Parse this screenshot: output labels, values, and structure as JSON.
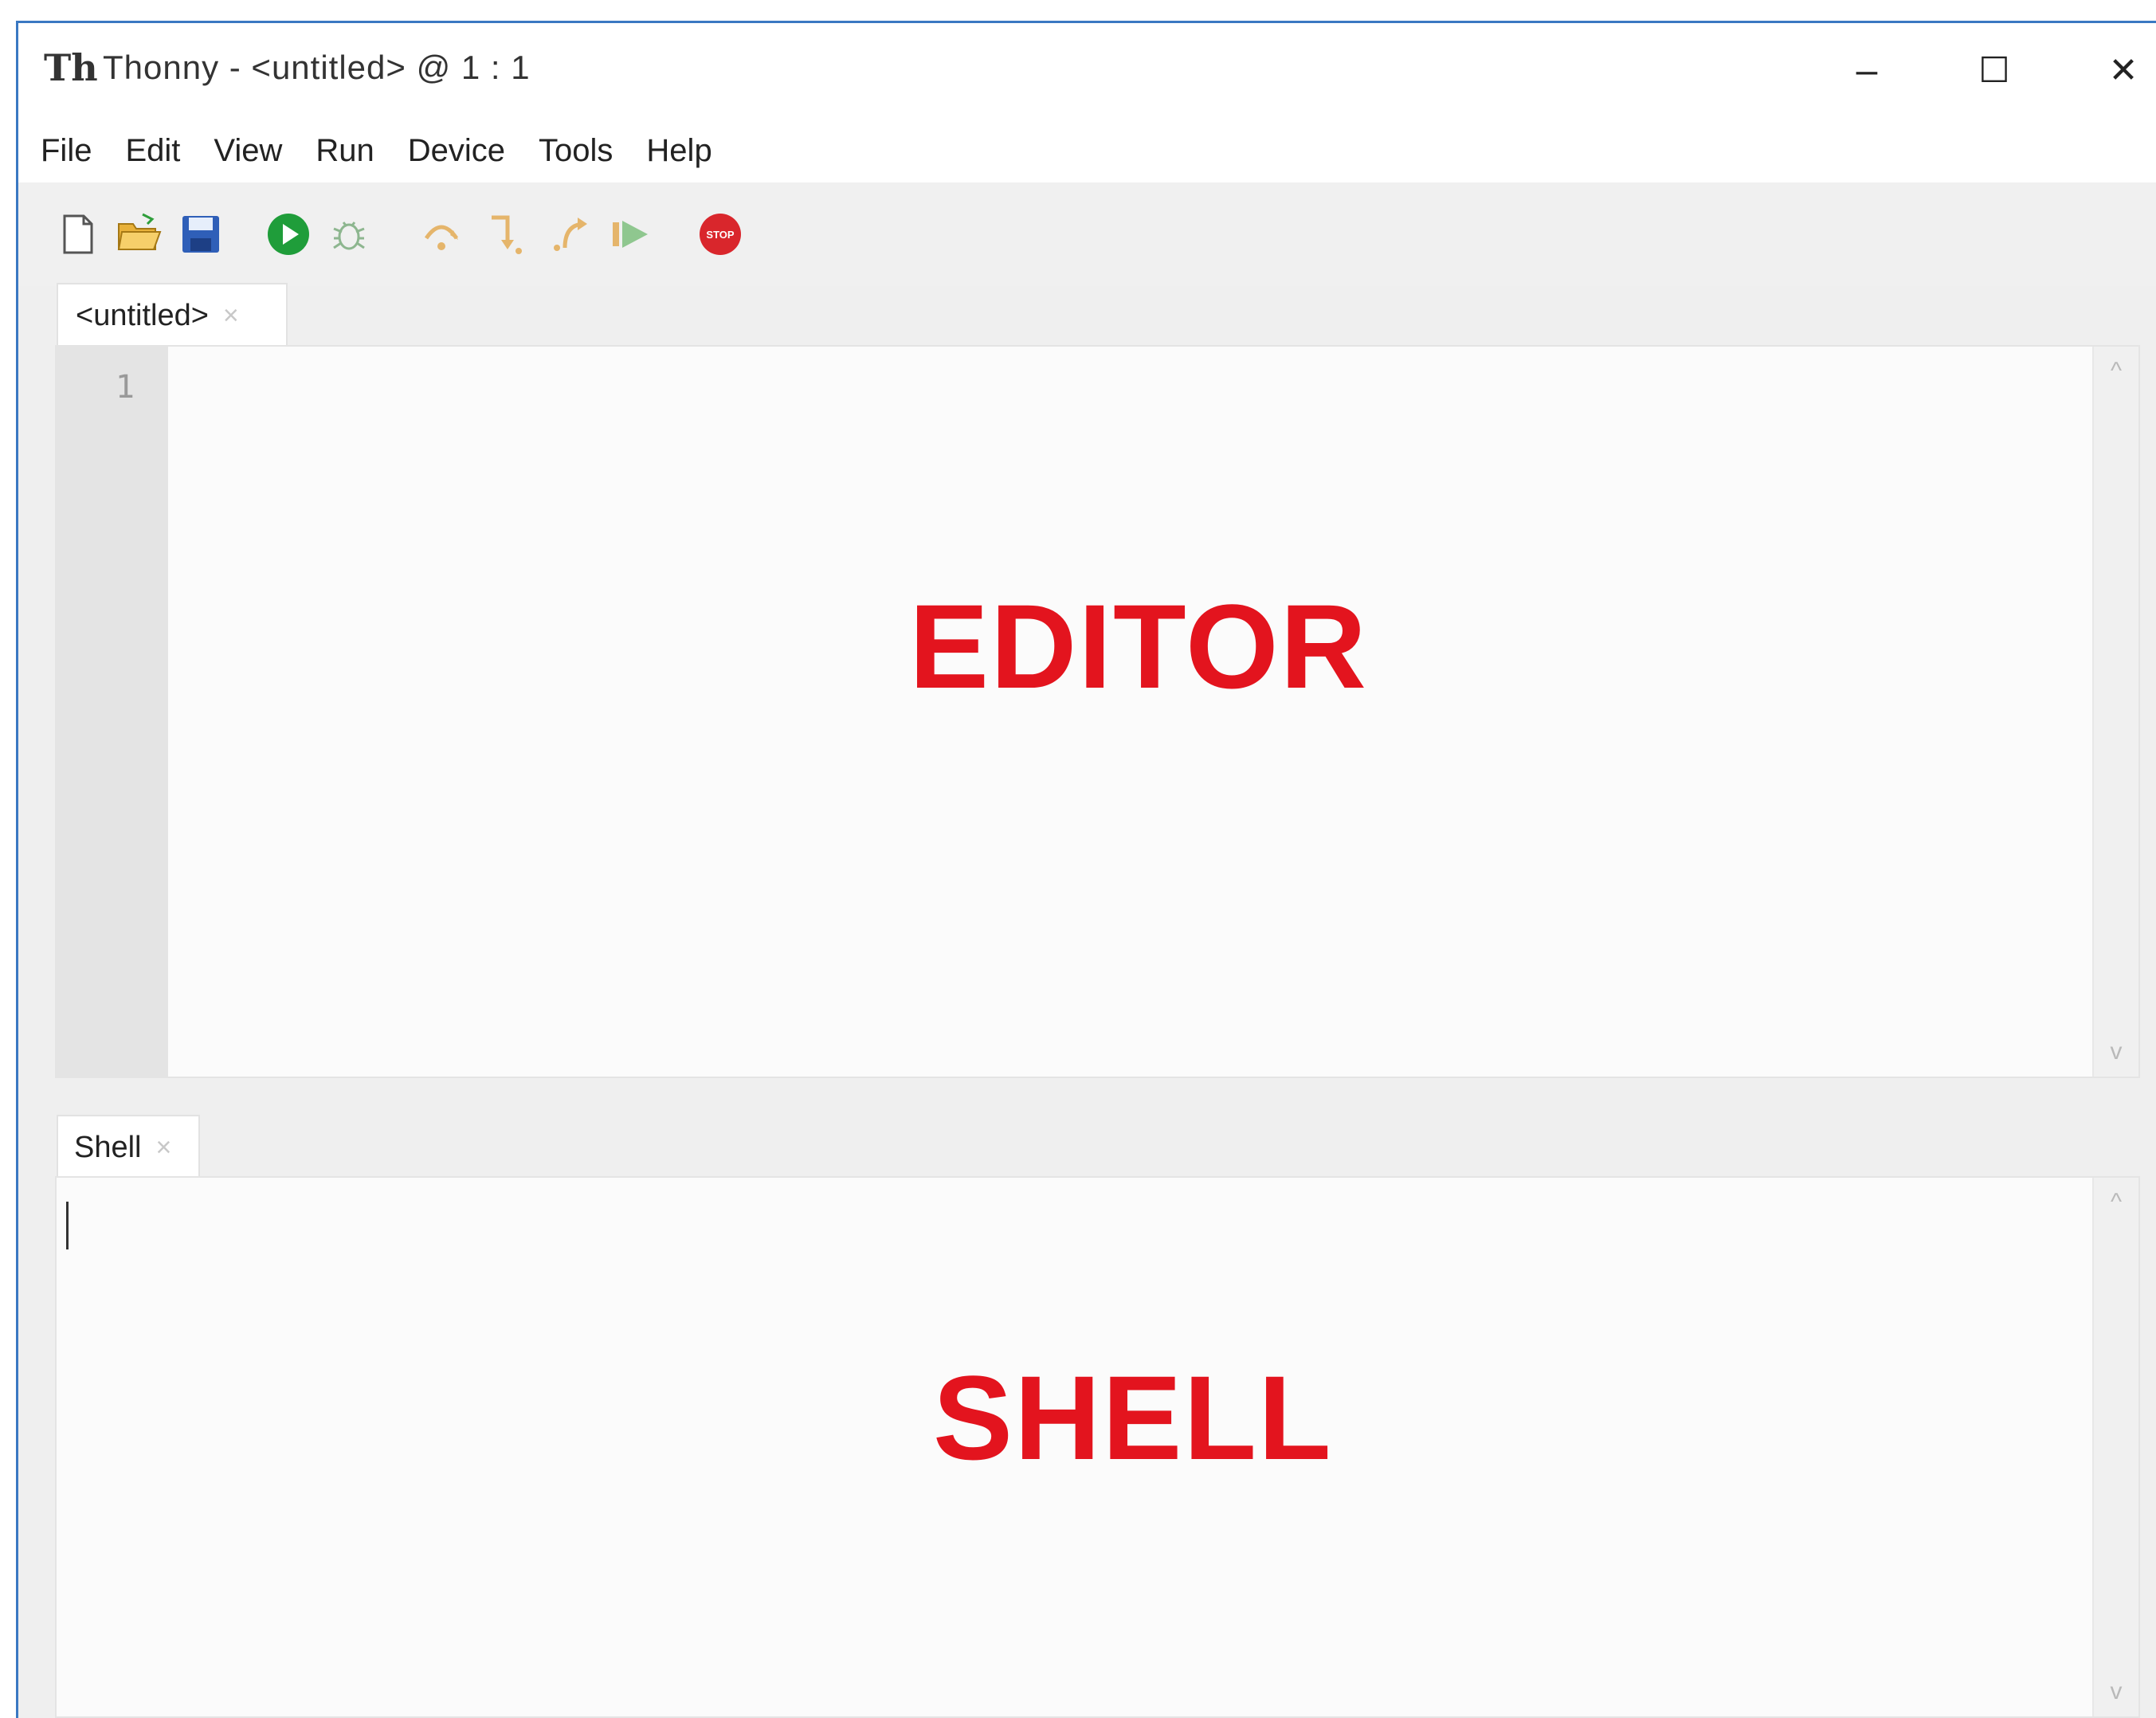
{
  "window": {
    "title": "Thonny  -  <untitled>  @  1 : 1",
    "logo_text": "Th",
    "controls": {
      "minimize": "–",
      "maximize": "☐",
      "close": "✕"
    }
  },
  "menu": {
    "items": [
      "File",
      "Edit",
      "View",
      "Run",
      "Device",
      "Tools",
      "Help"
    ]
  },
  "toolbar": {
    "icons": [
      "new-file-icon",
      "open-folder-icon",
      "save-icon",
      "run-icon",
      "debug-icon",
      "step-over-icon",
      "step-into-icon",
      "step-out-icon",
      "resume-icon",
      "stop-icon"
    ],
    "stop_label": "STOP"
  },
  "editor": {
    "tab_label": "<untitled>",
    "tab_close": "×",
    "line_numbers": [
      "1"
    ],
    "overlay_label": "EDITOR"
  },
  "shell": {
    "tab_label": "Shell",
    "tab_close": "×",
    "overlay_label": "SHELL"
  },
  "scroll": {
    "up": "^",
    "down": "v"
  },
  "colors": {
    "accent_label": "#e3141e",
    "window_border": "#3a78c2",
    "run_green": "#1f9d3a",
    "stop_red": "#d9262c"
  }
}
